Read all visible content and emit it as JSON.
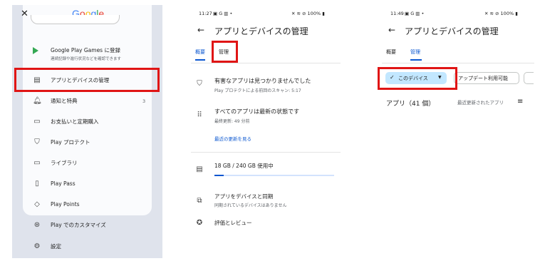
{
  "panel1": {
    "logo": [
      "G",
      "o",
      "o",
      "g",
      "l",
      "e"
    ],
    "logo_colors": [
      "#4285f4",
      "#ea4335",
      "#fbbc05",
      "#4285f4",
      "#34a853",
      "#ea4335"
    ],
    "close_icon": "close-icon",
    "games": {
      "title": "Google Play Games に登録",
      "subtitle": "連続記録や進行状況などを確認できます"
    },
    "items": [
      {
        "label": "アプリとデバイスの管理",
        "icon": "grid-icon"
      },
      {
        "label": "通知と特典",
        "icon": "bell-icon",
        "badge": "3"
      },
      {
        "label": "お支払いと定期購入",
        "icon": "card-icon"
      },
      {
        "label": "Play プロテクト",
        "icon": "shield-icon"
      },
      {
        "label": "ライブラリ",
        "icon": "folder-icon"
      },
      {
        "label": "Play Pass",
        "icon": "ticket-icon"
      },
      {
        "label": "Play Points",
        "icon": "diamond-icon"
      },
      {
        "label": "Play でのカスタマイズ",
        "icon": "customize-icon"
      },
      {
        "label": "設定",
        "icon": "gear-icon"
      }
    ]
  },
  "panel2": {
    "status_time": "11:27",
    "status_right": "100%",
    "title": "アプリとデバイスの管理",
    "tabs": [
      "概要",
      "管理"
    ],
    "rows": [
      {
        "title": "有害なアプリは見つかりませんでした",
        "subtitle": "Play プロテクトによる前回のスキャン: 5:17"
      },
      {
        "title": "すべてのアプリは最新の状態です",
        "subtitle": "最終更新: 49 分前"
      }
    ],
    "recent_link": "最近の更新を見る",
    "storage": {
      "label": "18 GB / 240 GB 使用中",
      "fraction": 0.075
    },
    "sync": {
      "title": "アプリをデバイスと同期",
      "subtitle": "同期されているデバイスはありません"
    },
    "ratings": "評価とレビュー"
  },
  "panel3": {
    "status_time": "11:49",
    "status_right": "100%",
    "title": "アプリとデバイスの管理",
    "tabs": [
      "概要",
      "管理"
    ],
    "chip_selected": "このデバイス",
    "chip_other": "アップデート利用可能",
    "count_label": "アプリ（41 個）",
    "sort_label": "最近更新されたアプリ"
  },
  "colors": {
    "highlight": "#e01515",
    "accent": "#0b57d0",
    "chip_bg": "#c2e7ff"
  }
}
